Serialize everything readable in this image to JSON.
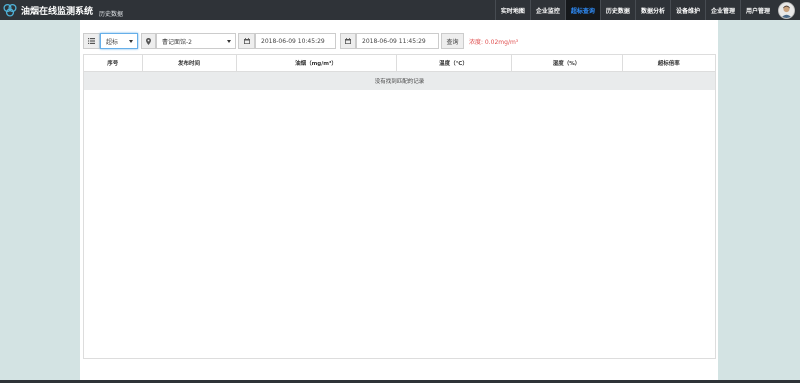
{
  "app": {
    "title": "油烟在线监测系统",
    "subtitle": "历史数据"
  },
  "nav": {
    "items": [
      {
        "label": "实时地图"
      },
      {
        "label": "企业监控"
      },
      {
        "label": "超标查询",
        "active": true
      },
      {
        "label": "历史数据"
      },
      {
        "label": "数据分析"
      },
      {
        "label": "设备维护"
      },
      {
        "label": "企业管理"
      },
      {
        "label": "用户管理"
      }
    ]
  },
  "filters": {
    "type_select": "超标",
    "device_select": "曹记面馆-2",
    "start_time": "2018-06-09 10:45:29",
    "end_time": "2018-06-09 11:45:29",
    "query_label": "查询",
    "density_text": "浓度: 0.02mg/m³"
  },
  "table": {
    "columns": [
      "序号",
      "发布时间",
      "油烟（mg/m³）",
      "温度（℃）",
      "湿度（%）",
      "超标倍率"
    ],
    "empty_text": "没有找到匹配的记录"
  },
  "colors": {
    "nav_bg": "#2f3338",
    "active_nav_text": "#2f8fff",
    "page_bg": "#d3e3e3",
    "density_text": "#e05050"
  }
}
